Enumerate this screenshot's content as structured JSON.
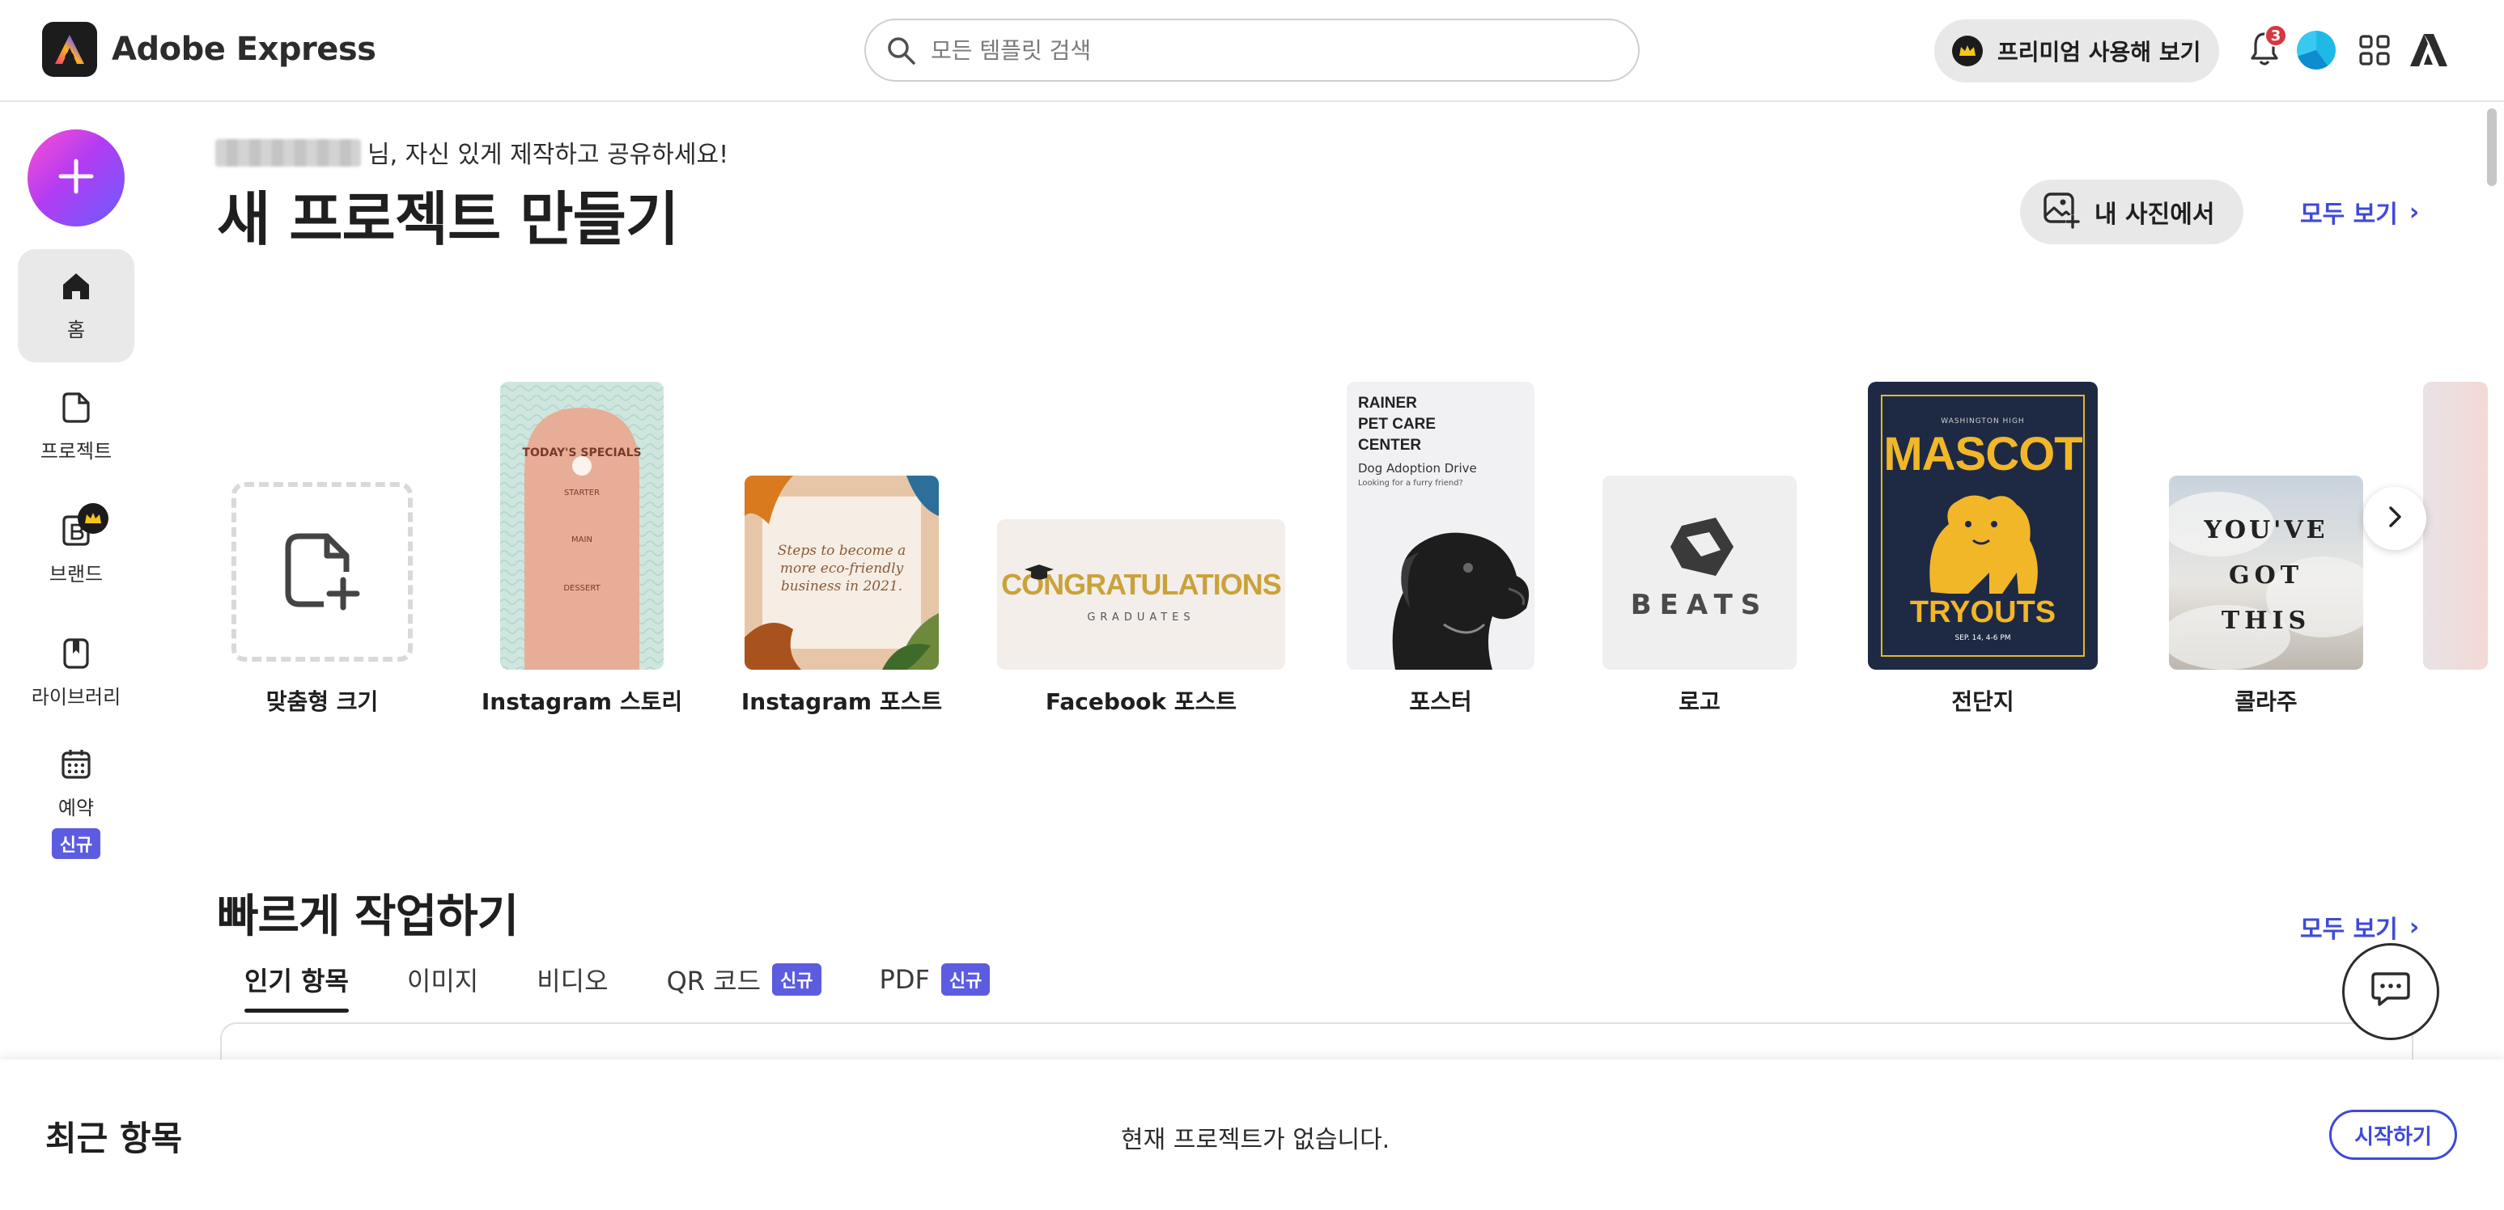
{
  "header": {
    "app_name": "Adobe Express",
    "search_placeholder": "모든 템플릿 검색",
    "premium_label": "프리미엄 사용해 보기",
    "notification_count": "3"
  },
  "sidebar": {
    "create_icon": "plus-icon",
    "items": [
      {
        "label": "홈",
        "icon": "home-icon",
        "active": true
      },
      {
        "label": "프로젝트",
        "icon": "project-icon"
      },
      {
        "label": "브랜드",
        "icon": "brand-icon"
      },
      {
        "label": "라이브러리",
        "icon": "library-icon"
      },
      {
        "label": "예약",
        "icon": "calendar-icon",
        "badge": "신규"
      }
    ]
  },
  "main": {
    "greeting_suffix": "님, 자신 있게 제작하고 공유하세요!",
    "title": "새 프로젝트 만들기",
    "photo_button": "내 사진에서",
    "see_all": "모두 보기"
  },
  "templates": [
    {
      "label": "맞춤형 크기"
    },
    {
      "label": "Instagram 스토리",
      "art": [
        "TODAY'S SPECIALS",
        "STARTER",
        "MAIN",
        "DESSERT"
      ]
    },
    {
      "label": "Instagram 포스트",
      "art": [
        "Steps to become a more eco-friendly business in 2021."
      ]
    },
    {
      "label": "Facebook 포스트",
      "art": [
        "CONGRATULATIONS",
        "GRADUATES"
      ]
    },
    {
      "label": "포스터",
      "art": [
        "RAINER",
        "PET CARE",
        "CENTER",
        "Dog Adoption Drive",
        "Looking for a furry friend?"
      ]
    },
    {
      "label": "로고",
      "art": [
        "BEATS"
      ]
    },
    {
      "label": "전단지",
      "art": [
        "WASHINGTON HIGH",
        "MASCOT",
        "TRYOUTS",
        "SEP. 14, 4-6 PM"
      ]
    },
    {
      "label": "콜라주",
      "art": [
        "YOU'VE",
        "GOT",
        "THIS"
      ]
    }
  ],
  "quick": {
    "title": "빠르게 작업하기",
    "see_all": "모두 보기",
    "tabs": [
      {
        "label": "인기 항목",
        "active": true
      },
      {
        "label": "이미지"
      },
      {
        "label": "비디오"
      },
      {
        "label": "QR 코드",
        "badge": "신규"
      },
      {
        "label": "PDF",
        "badge": "신규"
      }
    ]
  },
  "recent": {
    "title": "최근 항목",
    "empty_text": "현재 프로젝트가 없습니다.",
    "start_button": "시작하기"
  },
  "colors": {
    "accent": "#3f4ad8",
    "badge": "#5c5ce0",
    "notification": "#d7373f"
  }
}
